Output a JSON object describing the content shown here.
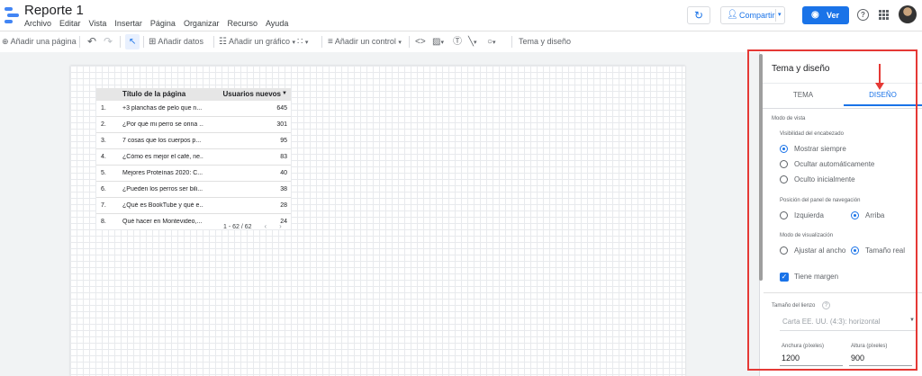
{
  "app": {
    "title": "Reporte 1",
    "menu": [
      "Archivo",
      "Editar",
      "Vista",
      "Insertar",
      "Página",
      "Organizar",
      "Recurso",
      "Ayuda"
    ],
    "share_label": "Compartir",
    "view_label": "Ver"
  },
  "toolbar": {
    "add_page": "Añadir una página",
    "add_data": "Añadir datos",
    "add_chart": "Añadir un gráfico",
    "add_control": "Añadir un control",
    "theme_layout": "Tema y diseño"
  },
  "table": {
    "headers": [
      "",
      "Título de la página",
      "Usuarios nuevos"
    ],
    "rows": [
      {
        "n": "1.",
        "title": "+3 planchas de pelo que n...",
        "value": "645"
      },
      {
        "n": "2.",
        "title": "¿Por qué mi perro se orina ...",
        "value": "301"
      },
      {
        "n": "3.",
        "title": "7 cosas que los cuerpos p...",
        "value": "95"
      },
      {
        "n": "4.",
        "title": "¿Cómo es mejor el café, ne...",
        "value": "83"
      },
      {
        "n": "5.",
        "title": "Mejores Proteínas 2020: C...",
        "value": "40"
      },
      {
        "n": "6.",
        "title": "¿Pueden los perros ser bili...",
        "value": "38"
      },
      {
        "n": "7.",
        "title": "¿Qué es BookTube y qué e...",
        "value": "28"
      },
      {
        "n": "8.",
        "title": "Qué hacer en Montevideo,...",
        "value": "24"
      }
    ],
    "pager": "1 - 62 / 62"
  },
  "panel": {
    "title": "Tema y diseño",
    "tabs": [
      "TEMA",
      "DISEÑO"
    ],
    "view_mode": "Modo de vista",
    "header_visibility": "Visibilidad del encabezado",
    "header_options": [
      "Mostrar siempre",
      "Ocultar automáticamente",
      "Oculto inicialmente"
    ],
    "nav_position": "Posición del panel de navegación",
    "nav_options": [
      "Izquierda",
      "Arriba"
    ],
    "display_mode": "Modo de visualización",
    "display_options": [
      "Ajustar al ancho",
      "Tamaño real"
    ],
    "margin_label": "Tiene margen",
    "canvas_size": "Tamaño del lienzo",
    "canvas_select": "Carta EE. UU. (4:3): horizontal",
    "width_label": "Anchura (píxeles)",
    "width_value": "1200",
    "height_label": "Altura (píxeles)",
    "height_value": "900"
  },
  "colors": {
    "accent": "#1a73e8",
    "annotation": "#e53935"
  }
}
